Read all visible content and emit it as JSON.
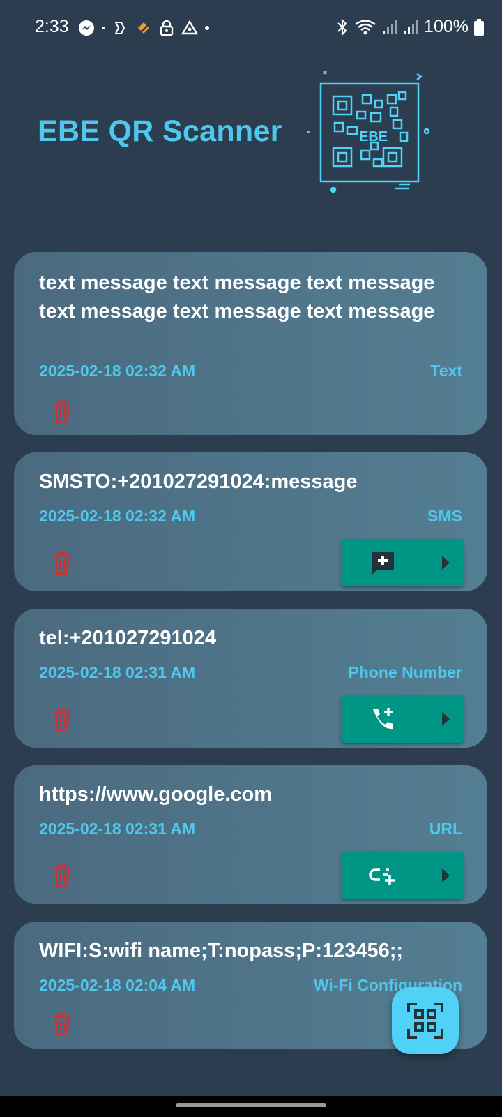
{
  "status_bar": {
    "time": "2:33",
    "battery": "100%",
    "left_icons": [
      "messenger-icon",
      "dot",
      "copilot-icon",
      "heart-app-icon",
      "lock-icon",
      "drive-icon",
      "dot"
    ],
    "right_icons": [
      "bluetooth-icon",
      "wifi-icon",
      "signal-icon",
      "signal-icon",
      "battery-icon"
    ]
  },
  "header": {
    "title": "EBE QR Scanner",
    "logo_text": "EBE"
  },
  "history": [
    {
      "content": "text message text message text message text message text message text message",
      "date": "2025-02-18 02:32 AM",
      "type": "Text",
      "action_icon": null
    },
    {
      "content": "SMSTO:+201027291024:message",
      "date": "2025-02-18 02:32 AM",
      "type": "SMS",
      "action_icon": "add-message-icon"
    },
    {
      "content": "tel:+201027291024",
      "date": "2025-02-18 02:31 AM",
      "type": "Phone Number",
      "action_icon": "add-call-icon"
    },
    {
      "content": "https://www.google.com",
      "date": "2025-02-18 02:31 AM",
      "type": "URL",
      "action_icon": "add-link-icon"
    },
    {
      "content": "WIFI:S:wifi name;T:nopass;P:123456;;",
      "date": "2025-02-18 02:04 AM",
      "type": "Wi-Fi Configuration",
      "action_icon": null
    }
  ],
  "fab": {
    "icon": "qr-scan-icon"
  },
  "colors": {
    "background": "#2c3d4f",
    "accent": "#4fc8ee",
    "card": "#547e93",
    "action_button": "#009686",
    "delete": "#d32f2f",
    "fab": "#4fd2f5"
  }
}
